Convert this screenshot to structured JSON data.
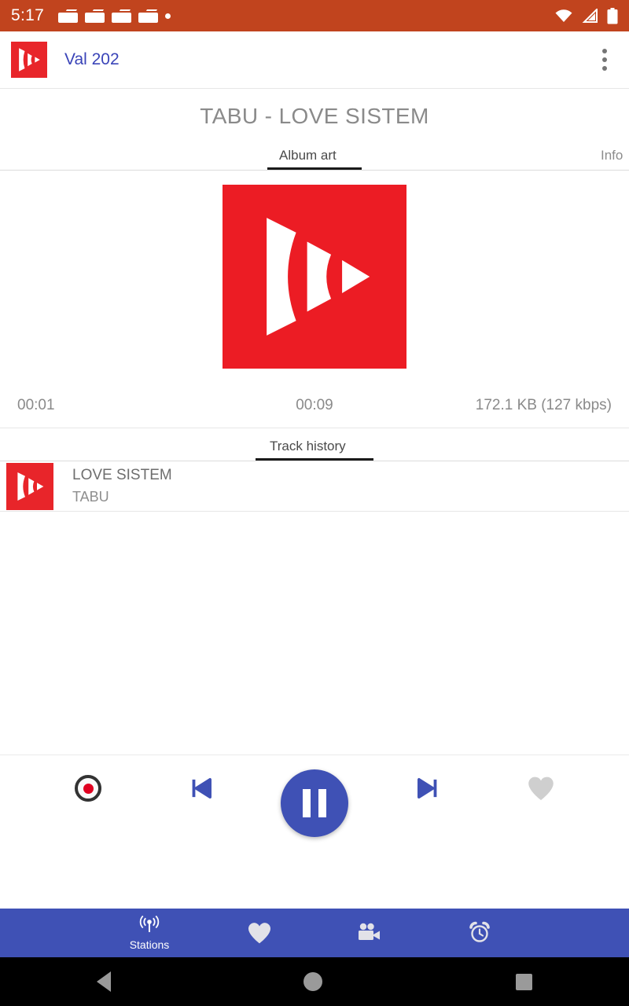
{
  "status_bar": {
    "time": "5:17",
    "left_icons": [
      "radio-icon",
      "radio-icon",
      "radio-icon",
      "radio-icon",
      "dot-icon"
    ],
    "right_icons": [
      "wifi-icon",
      "cell-signal-icon",
      "battery-icon"
    ],
    "background": "#c1441e"
  },
  "toolbar": {
    "station_name": "Val 202",
    "logo": "radio-app-logo",
    "overflow": "overflow-menu-icon",
    "accent": "#3a44b8"
  },
  "player": {
    "track_title": "TABU - LOVE SISTEM",
    "tabs": [
      {
        "label": "Album art",
        "active": true
      },
      {
        "label": "Info",
        "active": false
      }
    ],
    "album_art_alt": "radio-app-logo",
    "album_art_bg": "#ec1c24",
    "meta": {
      "elapsed": "00:01",
      "buffered": "00:09",
      "size_bitrate": "172.1 KB (127 kbps)"
    }
  },
  "history": {
    "tab_label": "Track history",
    "items": [
      {
        "title": "LOVE SISTEM",
        "artist": "TABU"
      }
    ]
  },
  "controls": {
    "record": "record-icon",
    "previous": "skip-previous-icon",
    "play_pause": "pause-icon",
    "next": "skip-next-icon",
    "favorite": "heart-icon",
    "fab_color": "#3f51b5"
  },
  "bottom_nav": {
    "background": "#3f51b5",
    "items": [
      {
        "label": "Stations",
        "icon": "broadcast-icon",
        "active": true
      },
      {
        "label": "",
        "icon": "heart-icon",
        "active": false
      },
      {
        "label": "",
        "icon": "video-camera-icon",
        "active": false
      },
      {
        "label": "",
        "icon": "alarm-clock-icon",
        "active": false
      }
    ]
  },
  "android_nav": {
    "back": "back-icon",
    "home": "home-icon",
    "recents": "recents-icon"
  }
}
